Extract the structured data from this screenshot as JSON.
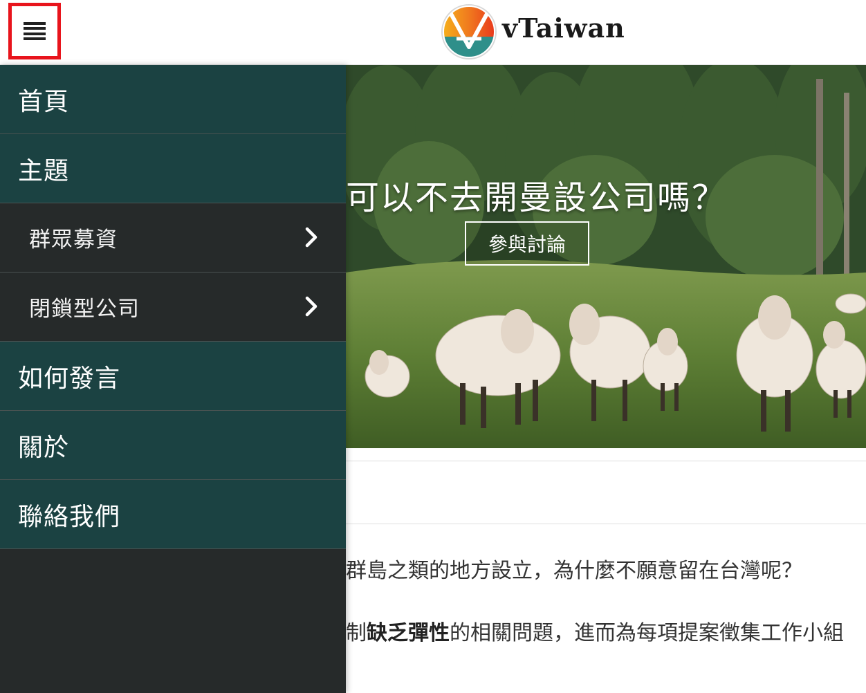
{
  "header": {
    "menu_icon": "hamburger-menu-icon",
    "logo_icon": "vtaiwan-logo-icon",
    "brand": "vTaiwan"
  },
  "drawer": {
    "items": [
      {
        "label": "首頁",
        "level": "top"
      },
      {
        "label": "主題",
        "level": "top"
      },
      {
        "label": "群眾募資",
        "level": "sub",
        "icon": "chevron-right-icon"
      },
      {
        "label": "閉鎖型公司",
        "level": "sub",
        "icon": "chevron-right-icon"
      },
      {
        "label": "如何發言",
        "level": "top"
      },
      {
        "label": "關於",
        "level": "top"
      },
      {
        "label": "聯絡我們",
        "level": "top"
      }
    ]
  },
  "hero": {
    "title": "可以不去開曼設公司嗎？",
    "button": "參與討論"
  },
  "content": {
    "para1": "群島之類的地方設立，為什麼不願意留在台灣呢？",
    "para2_pre": "制",
    "para2_bold": "缺乏彈性",
    "para2_post": "的相關問題，進而為每項提案徵集工作小組"
  },
  "colors": {
    "drawer_top_bg": "#1b4242",
    "drawer_sub_bg": "#262a2a",
    "highlight_border": "#e8141c"
  }
}
